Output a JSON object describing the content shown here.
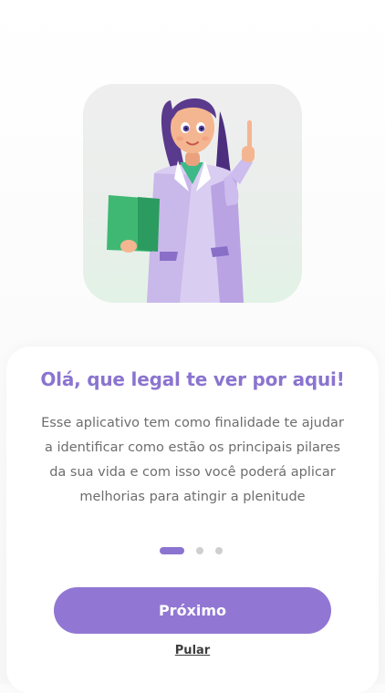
{
  "onboarding": {
    "title": "Olá, que legal te ver por aqui!",
    "description": "Esse aplicativo tem como finalidade te ajudar a identificar como estão os principais pilares da sua vida e com isso você poderá aplicar melhorias para atingir a plenitude",
    "illustration": "doctor-woman-illustration",
    "pagination": {
      "current": 1,
      "total": 3
    },
    "next_label": "Próximo",
    "skip_label": "Pular"
  },
  "colors": {
    "accent": "#8b74cf",
    "button": "#9177d3",
    "dot_inactive": "#cfcfcf",
    "text": "#6d6d6d"
  }
}
